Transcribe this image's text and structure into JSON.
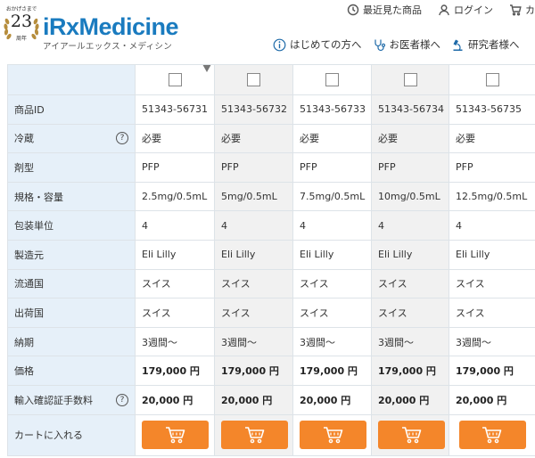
{
  "header": {
    "anniversary": {
      "top_text": "おかげさまで",
      "number": "23",
      "suffix": "周年"
    },
    "brand_name": "iRxMedicine",
    "brand_kana": "アイアールエックス・メディシン",
    "top_links": [
      {
        "label": "最近見た商品",
        "icon": "clock-icon"
      },
      {
        "label": "ログイン",
        "icon": "user-icon"
      },
      {
        "label": "カ",
        "icon": "cart-icon"
      }
    ],
    "sub_links": [
      {
        "label": "はじめての方へ",
        "icon": "info-icon"
      },
      {
        "label": "お医者様へ",
        "icon": "stethoscope-icon"
      },
      {
        "label": "研究者様へ",
        "icon": "microscope-icon"
      }
    ]
  },
  "table": {
    "rows": [
      {
        "label": "商品ID",
        "help": false,
        "bold": false,
        "values": [
          "51343-56731",
          "51343-56732",
          "51343-56733",
          "51343-56734",
          "51343-56735"
        ]
      },
      {
        "label": "冷蔵",
        "help": true,
        "bold": false,
        "values": [
          "必要",
          "必要",
          "必要",
          "必要",
          "必要"
        ]
      },
      {
        "label": "剤型",
        "help": false,
        "bold": false,
        "values": [
          "PFP",
          "PFP",
          "PFP",
          "PFP",
          "PFP"
        ]
      },
      {
        "label": "規格・容量",
        "help": false,
        "bold": false,
        "values": [
          "2.5mg/0.5mL",
          "5mg/0.5mL",
          "7.5mg/0.5mL",
          "10mg/0.5mL",
          "12.5mg/0.5mL"
        ]
      },
      {
        "label": "包装単位",
        "help": false,
        "bold": false,
        "values": [
          "4",
          "4",
          "4",
          "4",
          "4"
        ]
      },
      {
        "label": "製造元",
        "help": false,
        "bold": false,
        "values": [
          "Eli Lilly",
          "Eli Lilly",
          "Eli Lilly",
          "Eli Lilly",
          "Eli Lilly"
        ]
      },
      {
        "label": "流通国",
        "help": false,
        "bold": false,
        "values": [
          "スイス",
          "スイス",
          "スイス",
          "スイス",
          "スイス"
        ]
      },
      {
        "label": "出荷国",
        "help": false,
        "bold": false,
        "values": [
          "スイス",
          "スイス",
          "スイス",
          "スイス",
          "スイス"
        ]
      },
      {
        "label": "納期",
        "help": false,
        "bold": false,
        "values": [
          "3週間～",
          "3週間～",
          "3週間～",
          "3週間～",
          "3週間～"
        ]
      },
      {
        "label": "価格",
        "help": false,
        "bold": true,
        "values": [
          "179,000 円",
          "179,000 円",
          "179,000 円",
          "179,000 円",
          "179,000 円"
        ]
      },
      {
        "label": "輸入確認証手数料",
        "help": true,
        "bold": true,
        "values": [
          "20,000 円",
          "20,000 円",
          "20,000 円",
          "20,000 円",
          "20,000 円"
        ]
      }
    ],
    "cart_row_label": "カートに入れる",
    "help_glyph": "?",
    "cart_button_color": "#f4862a"
  },
  "colors": {
    "brand": "#1a7bbf",
    "label_bg": "#e6f0f9",
    "alt_col_bg": "#f1f1f1"
  }
}
